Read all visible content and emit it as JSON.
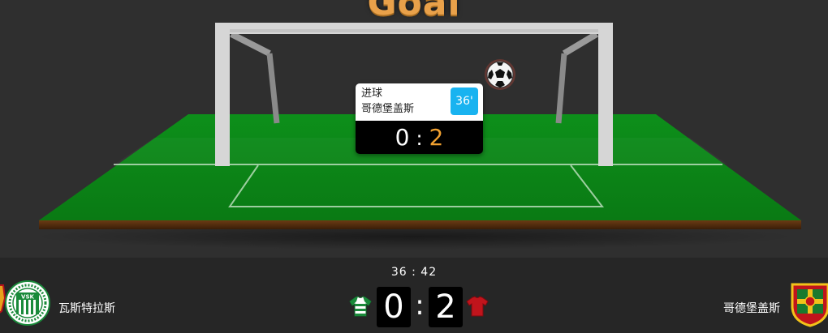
{
  "stage": {
    "title": "Goal",
    "popup": {
      "event": "进球",
      "team": "哥德堡盖斯",
      "minute": "36'",
      "home_score": "0",
      "separator": ":",
      "away_score": "2"
    }
  },
  "scorebar": {
    "clock": "36 : 42",
    "home_team": "瓦斯特拉斯",
    "away_team": "哥德堡盖斯",
    "home_score": "0",
    "separator": ":",
    "away_score": "2",
    "home_crest_text": "VSK",
    "colors": {
      "home_primary": "#1a8a3a",
      "away_primary": "#c0141c",
      "away_accent": "#f2c21a",
      "popup_minute_bg": "#19b3f0",
      "away_popup_score": "#f0a030"
    },
    "icons": {
      "home_jersey": "green-white-striped-jersey-icon",
      "away_jersey": "red-jersey-icon",
      "ball": "soccer-ball-icon"
    }
  }
}
